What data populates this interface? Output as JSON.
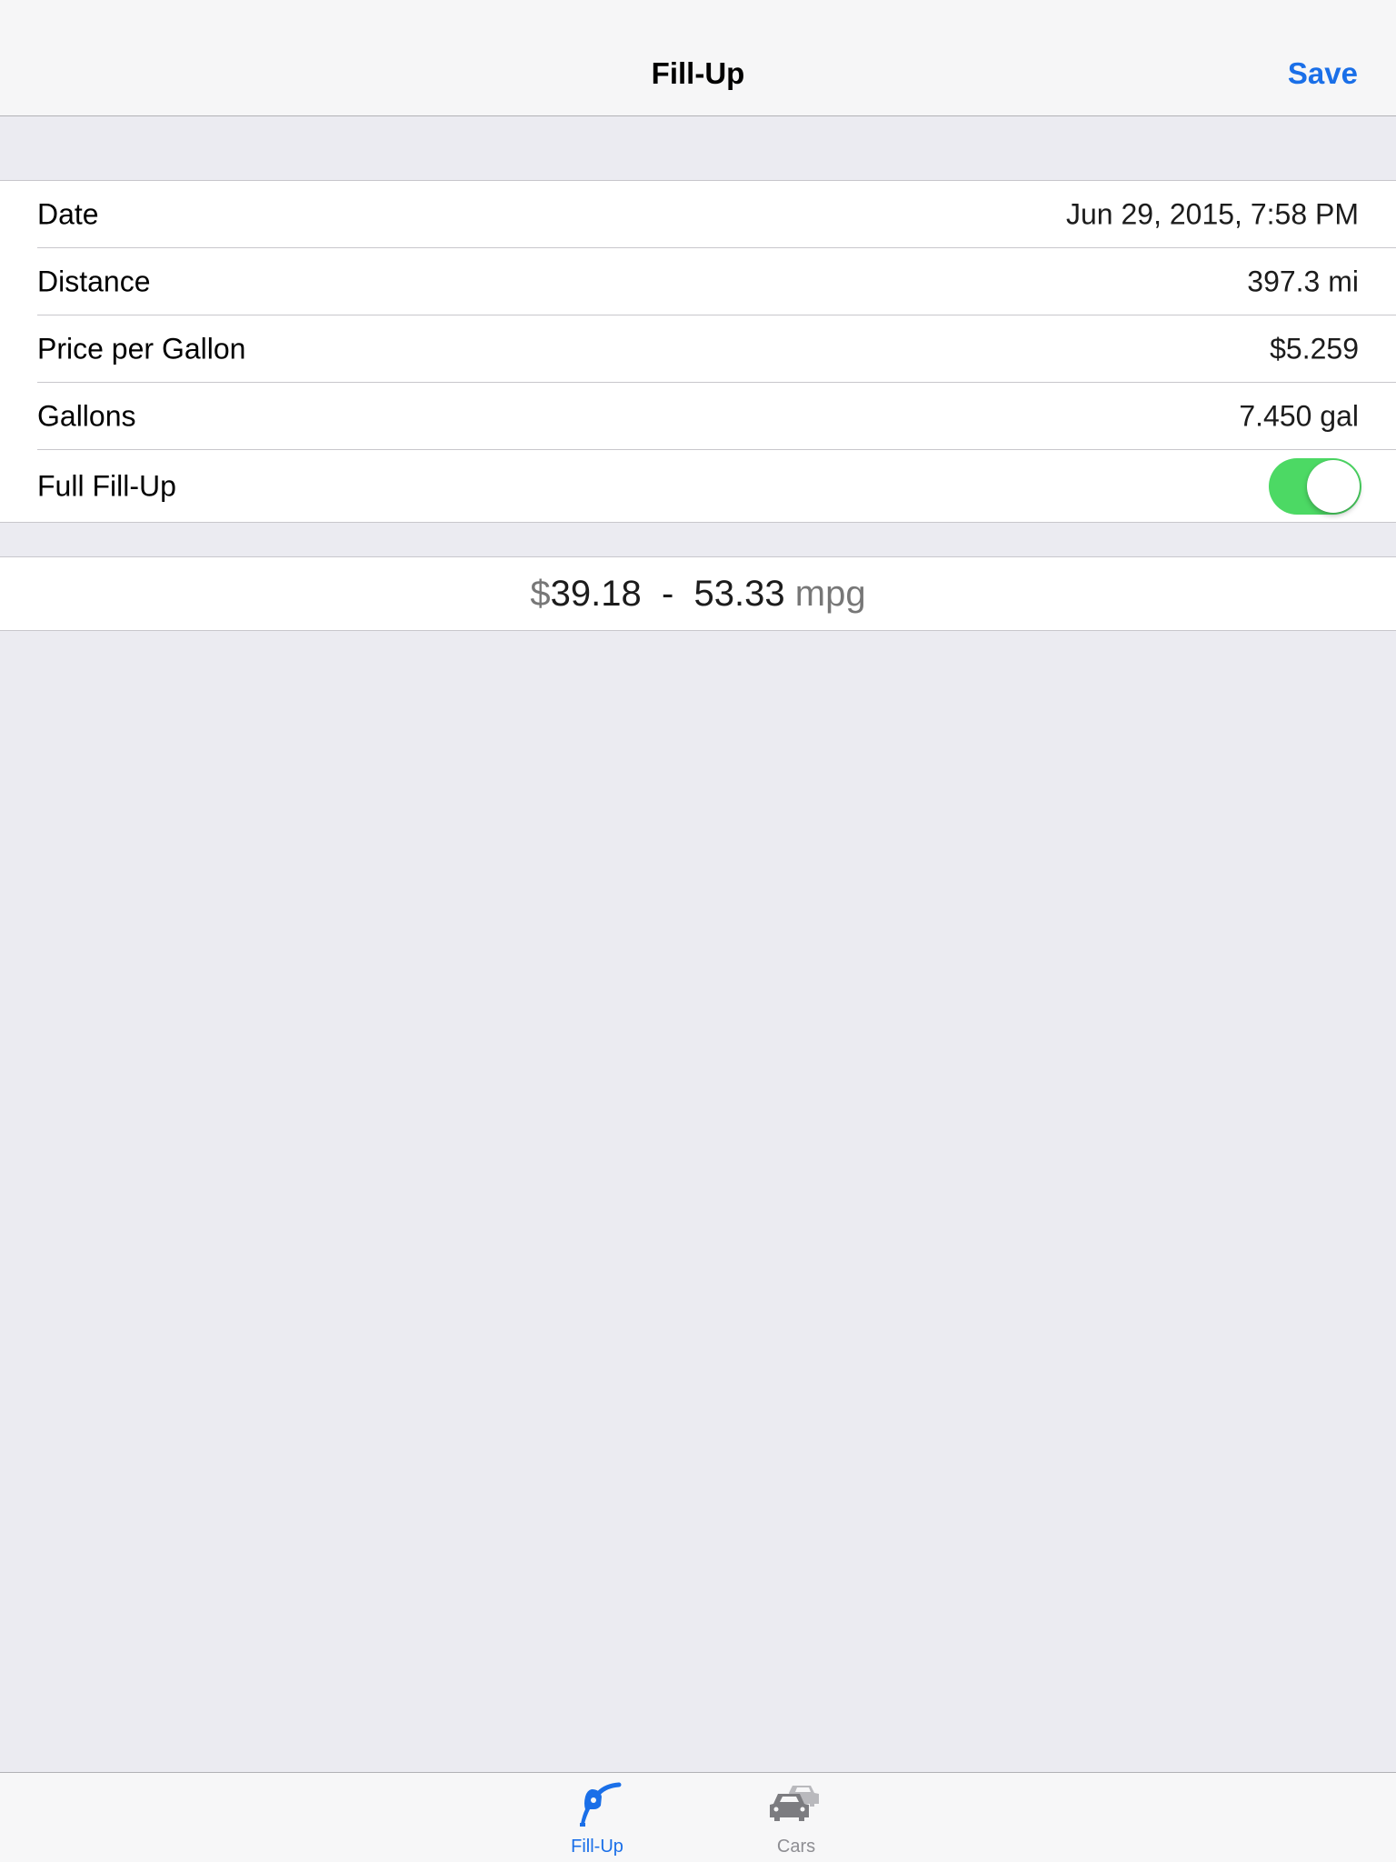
{
  "navbar": {
    "title": "Fill-Up",
    "save_label": "Save"
  },
  "form": {
    "rows": [
      {
        "label": "Date",
        "value": "Jun 29, 2015, 7:58 PM"
      },
      {
        "label": "Distance",
        "value": "397.3 mi"
      },
      {
        "label": "Price per Gallon",
        "value": "$5.259"
      },
      {
        "label": "Gallons",
        "value": "7.450 gal"
      }
    ],
    "full_fillup": {
      "label": "Full Fill-Up",
      "enabled": true
    }
  },
  "summary": {
    "currency_symbol": "$",
    "cost": "39.18",
    "separator": "-",
    "mpg_value": "53.33",
    "mpg_unit": "mpg"
  },
  "tabbar": {
    "tabs": [
      {
        "label": "Fill-Up",
        "icon": "fuel-nozzle-icon",
        "selected": true
      },
      {
        "label": "Cars",
        "icon": "cars-icon",
        "selected": false
      }
    ]
  },
  "colors": {
    "accent": "#1a6fe8",
    "toggle_on": "#4cd964",
    "background": "#ebebf1",
    "inactive_tab": "#8e8e93"
  }
}
